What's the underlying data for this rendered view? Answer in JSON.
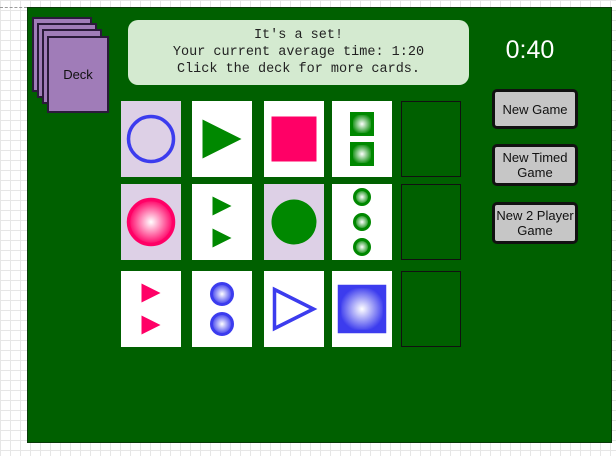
{
  "deck": {
    "label": "Deck"
  },
  "message": {
    "line1": "It's a set!",
    "line2": "Your current average time: 1:20",
    "line3": "Click the deck for more cards."
  },
  "timer": "0:40",
  "buttons": {
    "new_game": "New Game",
    "new_timed_game": "New Timed Game",
    "new_2_player_game": "New 2 Player Game"
  },
  "colors": {
    "board": "#006000",
    "selected_card": "#ddd0e6",
    "blue": "#3c3cee",
    "green": "#008800",
    "pink": "#ff0066",
    "deck": "#a07cb8"
  },
  "cards": [
    {
      "row": 1,
      "col": 1,
      "selected": true,
      "shape": "circle",
      "number": 1,
      "color": "blue",
      "fill": "empty"
    },
    {
      "row": 1,
      "col": 2,
      "selected": false,
      "shape": "triangle",
      "number": 1,
      "color": "green",
      "fill": "solid"
    },
    {
      "row": 1,
      "col": 3,
      "selected": false,
      "shape": "square",
      "number": 1,
      "color": "pink",
      "fill": "solid"
    },
    {
      "row": 1,
      "col": 4,
      "selected": false,
      "shape": "square",
      "number": 2,
      "color": "green",
      "fill": "shaded"
    },
    {
      "row": 1,
      "col": 5,
      "empty": true
    },
    {
      "row": 2,
      "col": 1,
      "selected": true,
      "shape": "circle",
      "number": 1,
      "color": "pink",
      "fill": "shaded"
    },
    {
      "row": 2,
      "col": 2,
      "selected": false,
      "shape": "triangle",
      "number": 2,
      "color": "green",
      "fill": "solid"
    },
    {
      "row": 2,
      "col": 3,
      "selected": true,
      "shape": "circle",
      "number": 1,
      "color": "green",
      "fill": "solid"
    },
    {
      "row": 2,
      "col": 4,
      "selected": false,
      "shape": "circle",
      "number": 3,
      "color": "green",
      "fill": "shaded"
    },
    {
      "row": 2,
      "col": 5,
      "empty": true
    },
    {
      "row": 3,
      "col": 1,
      "selected": false,
      "shape": "triangle",
      "number": 2,
      "color": "pink",
      "fill": "solid"
    },
    {
      "row": 3,
      "col": 2,
      "selected": false,
      "shape": "circle",
      "number": 2,
      "color": "blue",
      "fill": "shaded"
    },
    {
      "row": 3,
      "col": 3,
      "selected": false,
      "shape": "triangle",
      "number": 1,
      "color": "blue",
      "fill": "empty"
    },
    {
      "row": 3,
      "col": 4,
      "selected": false,
      "shape": "square",
      "number": 1,
      "color": "blue",
      "fill": "shaded"
    },
    {
      "row": 3,
      "col": 5,
      "empty": true
    }
  ]
}
